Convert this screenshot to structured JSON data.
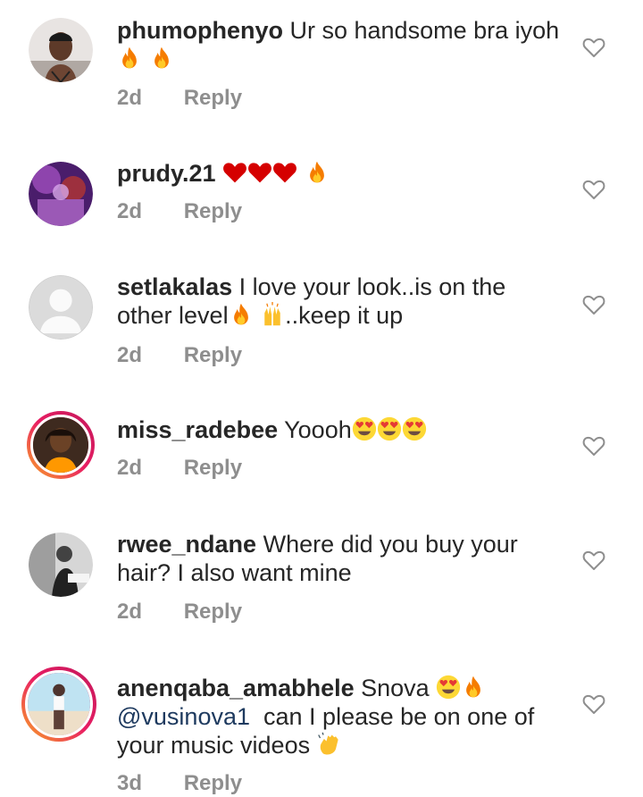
{
  "comments": [
    {
      "username": "phumophenyo",
      "text": "Ur so handsome bra iyoh",
      "emojis_line2": [
        "fire",
        "fire"
      ],
      "time": "2d",
      "reply": "Reply",
      "avatar": "man-portrait"
    },
    {
      "username": "prudy.21",
      "text": "",
      "emojis": [
        "red-heart",
        "red-heart",
        "red-heart",
        "fire"
      ],
      "time": "2d",
      "reply": "Reply",
      "avatar": "purple-photo"
    },
    {
      "username": "setlakalas",
      "text_part1": "I love your look..is on the",
      "text_part2": "other level",
      "text_part3": "..keep it up",
      "emojis": [
        "fire",
        "raising-hands"
      ],
      "time": "2d",
      "reply": "Reply",
      "avatar": "default-placeholder"
    },
    {
      "username": "miss_radebee",
      "text": "Yoooh",
      "emojis": [
        "heart-eyes",
        "heart-eyes",
        "heart-eyes"
      ],
      "time": "2d",
      "reply": "Reply",
      "avatar": "woman-portrait",
      "story_ring": true
    },
    {
      "username": "rwee_ndane",
      "text_part1": "Where did you buy your",
      "text_part2": "hair? I also want mine",
      "time": "2d",
      "reply": "Reply",
      "avatar": "bw-photo"
    },
    {
      "username": "anenqaba_amabhele",
      "text_part1": "Snova",
      "mention": "@vusinova1",
      "text_part2": "can I please be on one of",
      "text_part3": "your music videos",
      "emojis": [
        "heart-eyes",
        "fire",
        "waving-hand"
      ],
      "time": "3d",
      "reply": "Reply",
      "avatar": "beach-photo",
      "story_ring": true
    }
  ],
  "colors": {
    "text": "#262626",
    "meta": "#8e8e8e",
    "mention": "#1e3a5f",
    "heart_icon": "#8e8e8e"
  }
}
